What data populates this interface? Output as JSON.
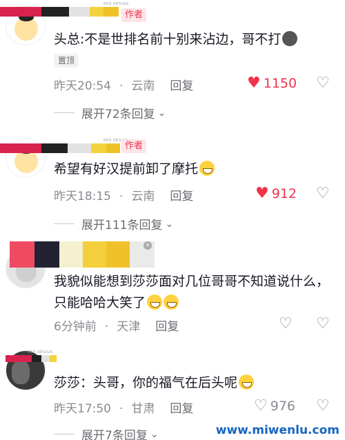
{
  "comments": [
    {
      "author_badge": "作者",
      "tiny_caption": "RED DESIGN",
      "text": "头总:不是世排名前十别来沾边，哥不打",
      "pin_tag": "置顶",
      "time": "昨天20:54",
      "location": "云南",
      "reply_label": "回复",
      "likes": "1150",
      "liked": true,
      "expand": "展开72条回复",
      "swatches": [
        "#d9234f",
        "#222222",
        "#e2e2e2",
        "#f3d33c",
        "#f0c22a"
      ]
    },
    {
      "author_badge": "作者",
      "tiny_caption": "RED DESIGN",
      "text": "希望有好汉提前卸了摩托",
      "time": "昨天18:15",
      "location": "云南",
      "reply_label": "回复",
      "likes": "912",
      "liked": true,
      "expand": "展开111条回复",
      "swatches": [
        "#d9234f",
        "#222222",
        "#e2e2e2",
        "#f3d33c",
        "#f0c22a"
      ]
    },
    {
      "text": "我貌似能想到莎莎面对几位哥哥不知道说什么，只能哈哈大笑了",
      "time": "6分钟前",
      "location": "天津",
      "reply_label": "回复",
      "liked": false,
      "swatches": [
        "#f04a63",
        "#222233",
        "#f5f0d0",
        "#f3cf3c",
        "#eaeaea"
      ]
    },
    {
      "tiny_caption": "RED DESIGN",
      "text": "莎莎：头哥，你的福气在后头呢",
      "time": "昨天17:50",
      "location": "甘肃",
      "reply_label": "回复",
      "likes": "976",
      "liked": false,
      "expand": "展开7条回复",
      "swatches": [
        "#d9234f",
        "#d9234f",
        "#222222",
        "#e2e2e2",
        "#f3d33c"
      ]
    }
  ],
  "watermark": "www.miwenlu.com",
  "icons": {
    "heart": "heart-icon",
    "dislike": "broken-heart-icon",
    "chevron": "chevron-down-icon"
  },
  "colors": {
    "accent": "#f0334a",
    "meta": "#8a8b91",
    "watermark": "#1565c0"
  }
}
